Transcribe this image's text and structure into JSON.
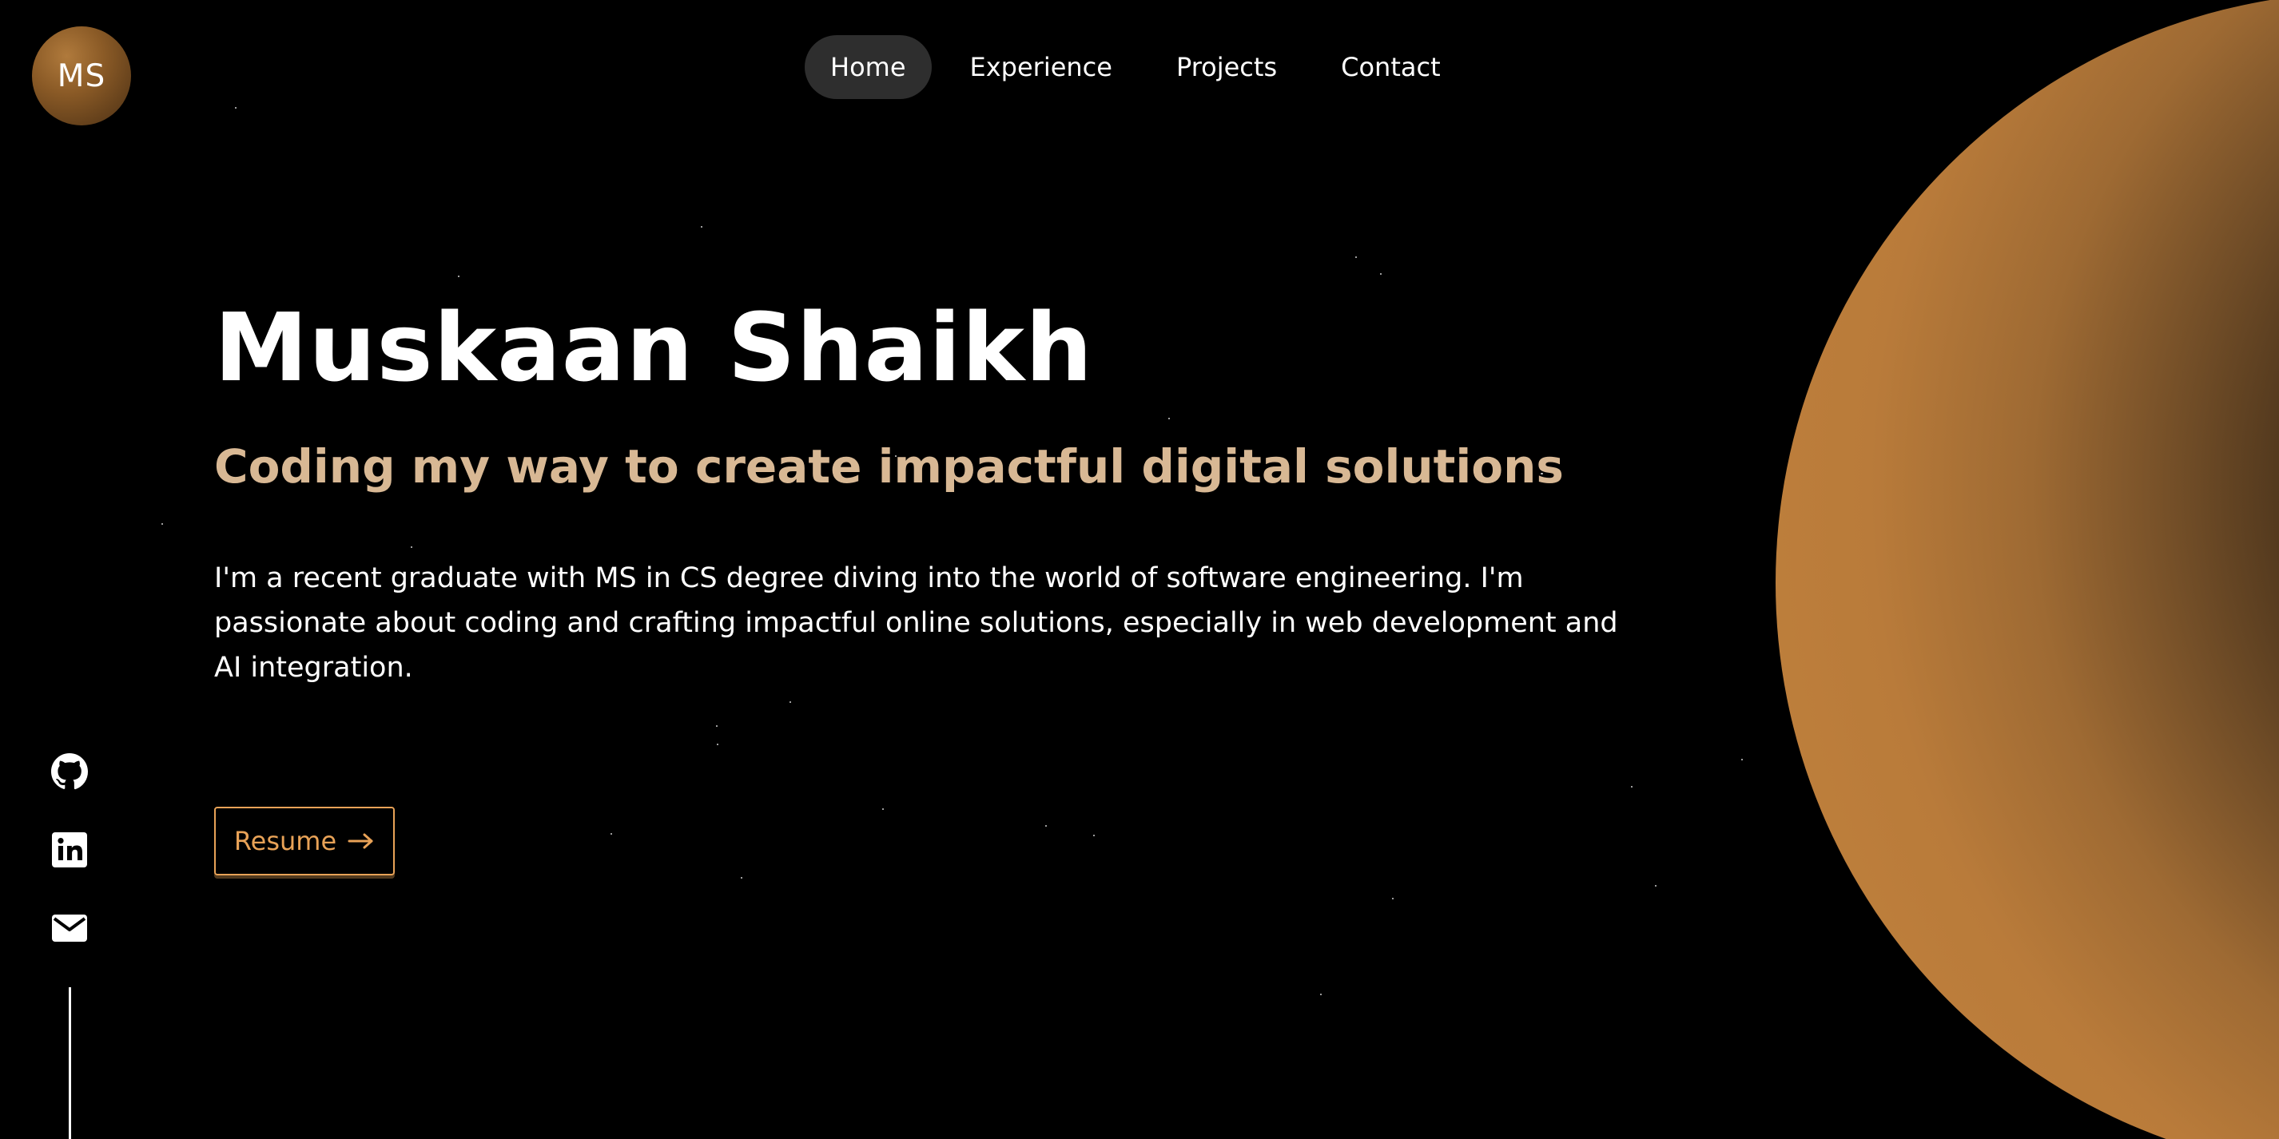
{
  "logo": {
    "initials": "MS"
  },
  "nav": {
    "items": [
      {
        "label": "Home",
        "active": true
      },
      {
        "label": "Experience",
        "active": false
      },
      {
        "label": "Projects",
        "active": false
      },
      {
        "label": "Contact",
        "active": false
      }
    ]
  },
  "hero": {
    "name": "Muskaan Shaikh",
    "tagline": "Coding my way to create impactful digital solutions",
    "bio": "I'm a recent graduate with MS in CS degree diving into the world of software engineering. I'm passionate about coding and crafting impactful online solutions, especially in web development and AI integration.",
    "resume_label": "Resume"
  },
  "social": {
    "icons": [
      "github-icon",
      "linkedin-icon",
      "mail-icon"
    ]
  },
  "colors": {
    "background": "#000000",
    "tagline": "#d8b894",
    "accent": "#e8a257",
    "nav_active_bg": "#2e2e2e",
    "planet": "#c4843e"
  }
}
